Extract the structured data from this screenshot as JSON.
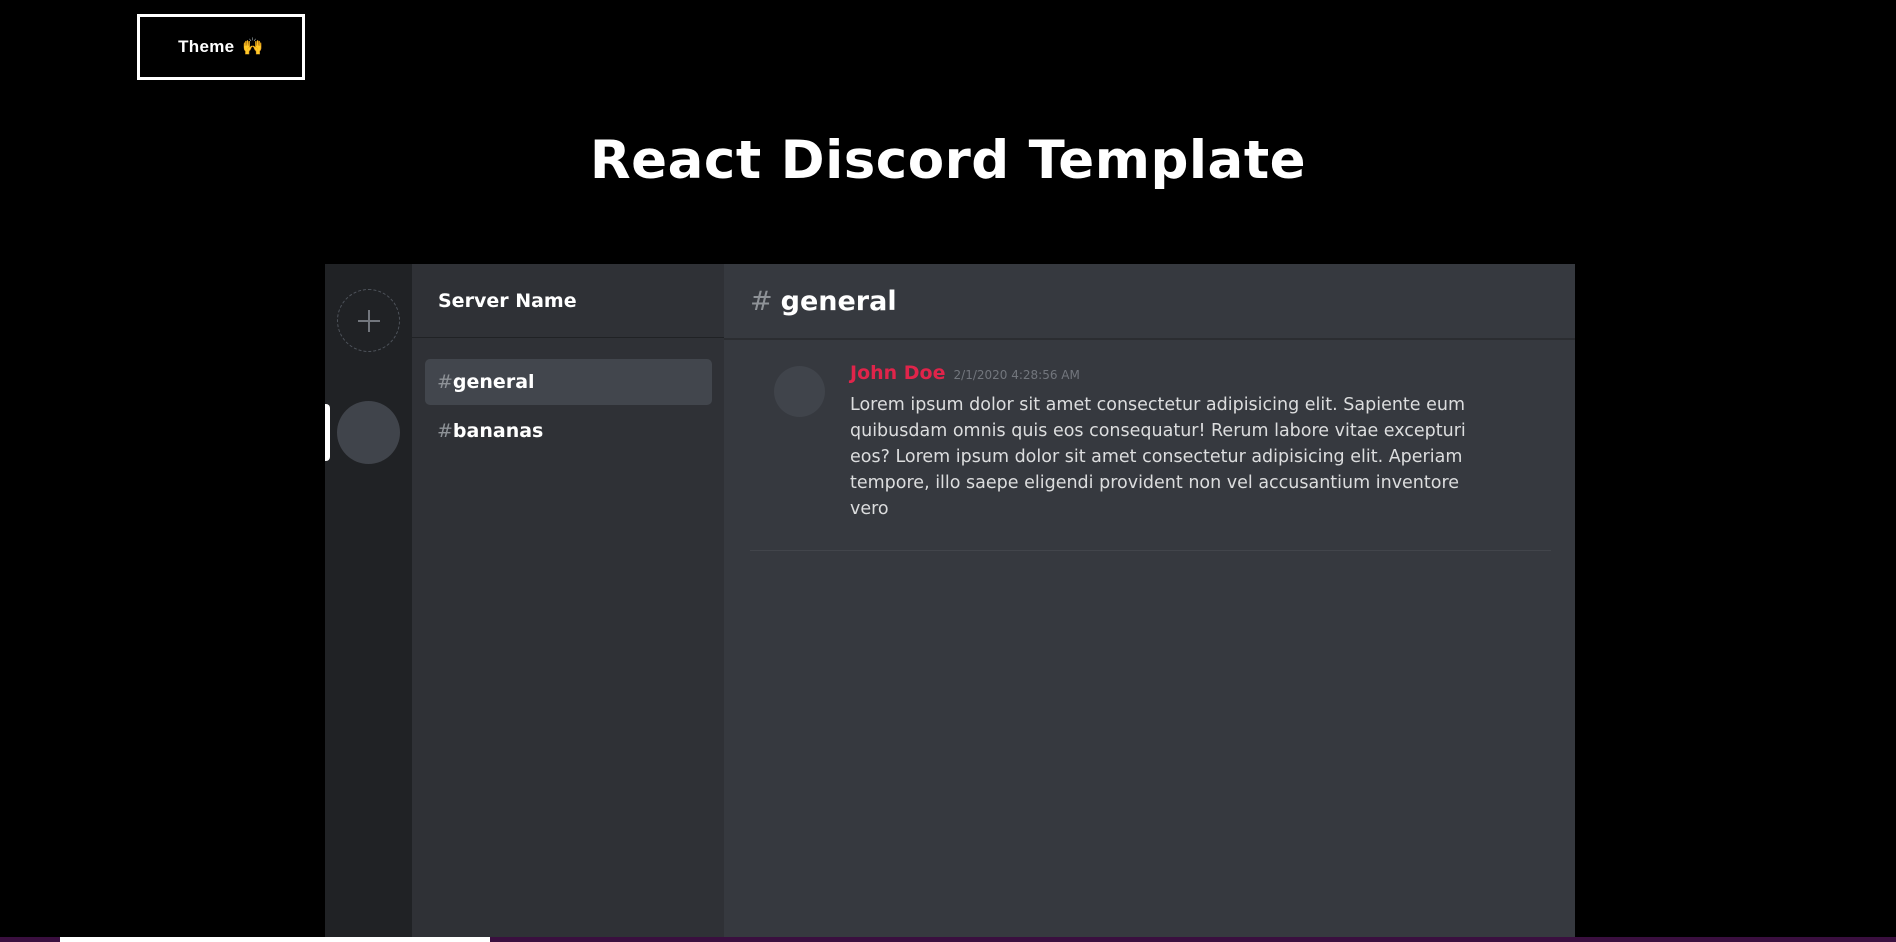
{
  "theme_button": {
    "label": "Theme",
    "emoji": "🙌"
  },
  "page": {
    "title": "React Discord Template"
  },
  "server_rail": {
    "add_icon": "plus-icon",
    "servers": [
      {
        "selected": true
      }
    ]
  },
  "sidebar": {
    "server_name": "Server Name",
    "channels": [
      {
        "hash": "#",
        "name": "general",
        "active": true
      },
      {
        "hash": "#",
        "name": "bananas",
        "active": false
      }
    ]
  },
  "chat": {
    "header": {
      "hash": "#",
      "channel": "general"
    },
    "messages": [
      {
        "author": "John Doe",
        "timestamp": "2/1/2020 4:28:56 AM",
        "text": "Lorem ipsum dolor sit amet consectetur adipisicing elit. Sapiente eum quibusdam omnis quis eos consequatur! Rerum labore vitae excepturi eos? Lorem ipsum dolor sit amet consectetur adipisicing elit. Aperiam tempore, illo saepe eligendi provident non vel accusantium inventore vero"
      }
    ]
  },
  "colors": {
    "background": "#000000",
    "rail": "#202225",
    "sidebar": "#2f3136",
    "chat": "#36393f",
    "author": "#e0244a"
  }
}
